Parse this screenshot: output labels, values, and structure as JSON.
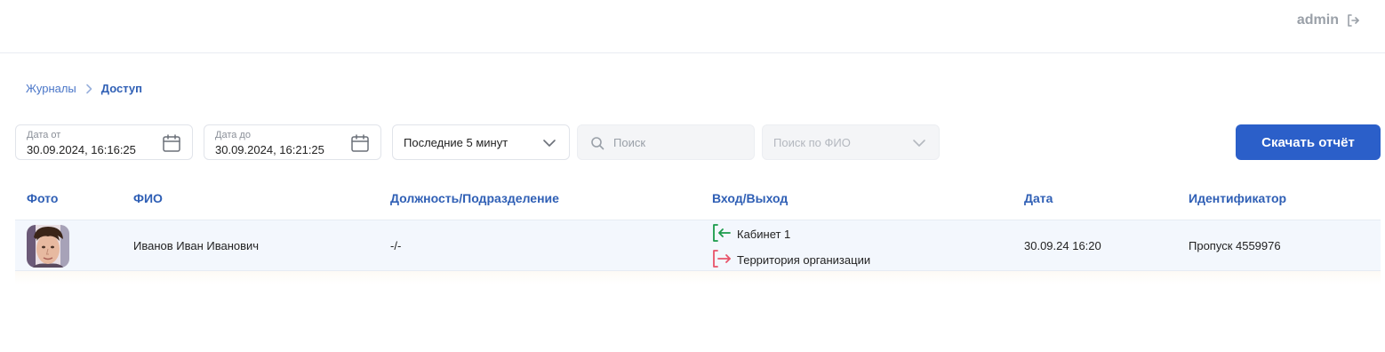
{
  "header": {
    "user": "admin"
  },
  "breadcrumb": {
    "parent": "Журналы",
    "current": "Доступ"
  },
  "filters": {
    "date_from": {
      "label": "Дата от",
      "value": "30.09.2024, 16:16:25"
    },
    "date_to": {
      "label": "Дата до",
      "value": "30.09.2024, 16:21:25"
    },
    "period": "Последние 5 минут",
    "search_placeholder": "Поиск",
    "fio_placeholder": "Поиск по ФИО",
    "download_label": "Скачать отчёт"
  },
  "table": {
    "columns": [
      "Фото",
      "ФИО",
      "Должность/Подразделение",
      "Вход/Выход",
      "Дата",
      "Идентификатор"
    ],
    "rows": [
      {
        "name": "Иванов Иван Иванович",
        "position": "-/-",
        "entry": "Кабинет 1",
        "exit": "Территория организации",
        "date": "30.09.24 16:20",
        "identifier": "Пропуск 4559976"
      }
    ]
  },
  "colors": {
    "accent": "#2b5fc9",
    "entry": "#1a9a4a",
    "exit": "#e8536a"
  }
}
